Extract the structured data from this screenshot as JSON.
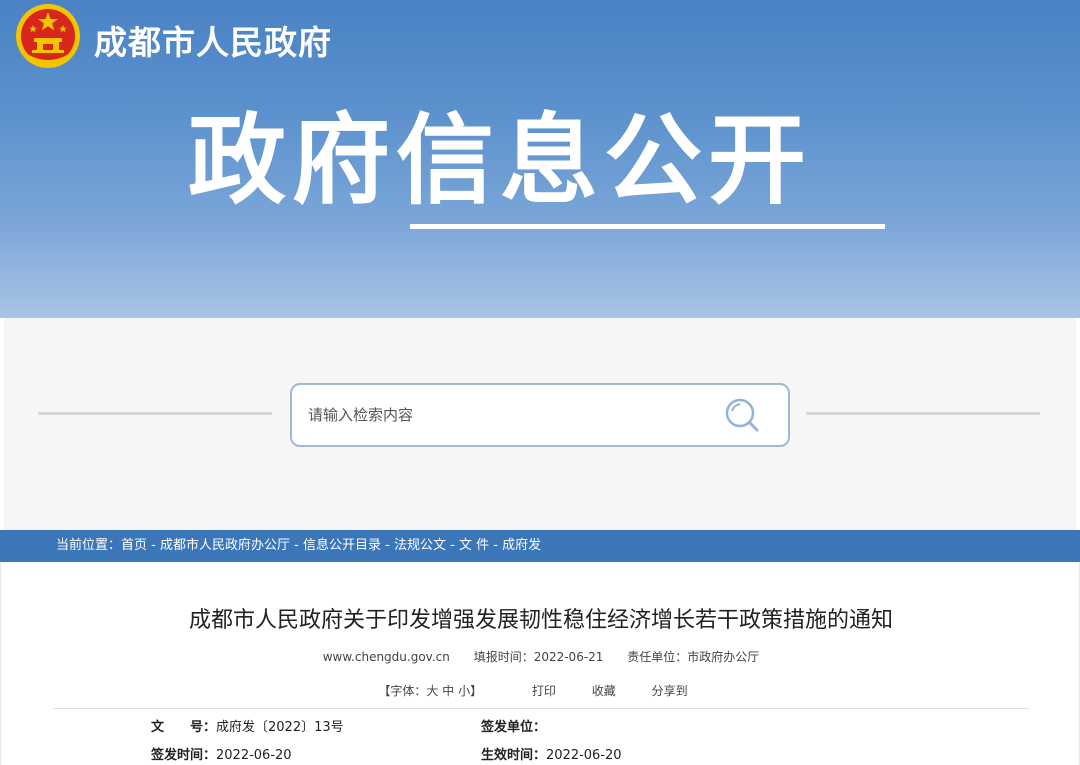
{
  "header": {
    "site_name": "成都市人民政府",
    "banner_title": "政府信息公开"
  },
  "search": {
    "placeholder": "请输入检索内容"
  },
  "breadcrumb": {
    "label": "当前位置：",
    "items": [
      "首页",
      "成都市人民政府办公厅",
      "信息公开目录",
      "法规公文",
      "文 件",
      "成府发"
    ],
    "separator": " - "
  },
  "article": {
    "title": "成都市人民政府关于印发增强发展韧性稳住经济增长若干政策措施的通知",
    "source": "www.chengdu.gov.cn",
    "report_time": "填报时间：2022-06-21",
    "responsible_unit": "责任单位：市政府办公厅",
    "font_size": {
      "prefix": "【字体：",
      "large": "大",
      "medium": "中",
      "small": "小",
      "suffix": "】"
    },
    "print_label": "打印",
    "favorite_label": "收藏",
    "share_label": "分享到",
    "doc_number_label": "文　　号：",
    "doc_number_value": "成府发〔2022〕13号",
    "issuing_unit_label": "签发单位：",
    "issuing_unit_value": "",
    "issue_date_label": "签发时间：",
    "issue_date_value": "2022-06-20",
    "effective_date_label": "生效时间：",
    "effective_date_value": "2022-06-20"
  },
  "colors": {
    "banner_top": "#4a82c4",
    "banner_bottom": "#a9c4e6",
    "breadcrumb_bg": "#3b76b8",
    "search_border": "#9fb8d4",
    "emblem_red": "#d7261b",
    "emblem_gold": "#f5c400"
  },
  "icons": {
    "emblem": "national-emblem-icon",
    "search": "search-icon"
  }
}
